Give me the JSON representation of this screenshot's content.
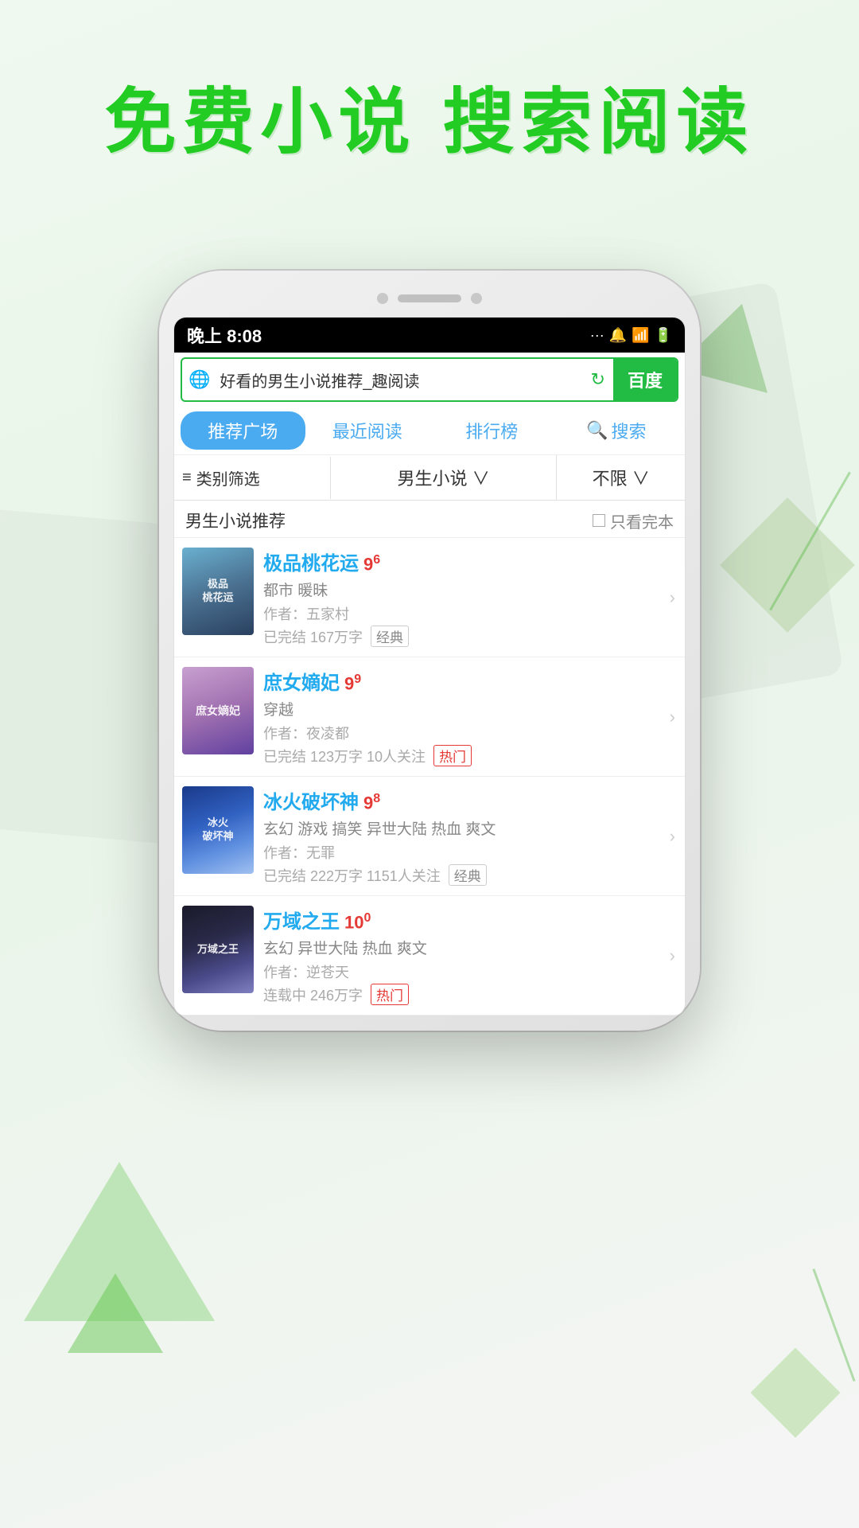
{
  "headline": {
    "line1": "免费小说  搜索阅读"
  },
  "status_bar": {
    "time": "晚上 8:08",
    "icons": "... 🔔 📶 🔋"
  },
  "search": {
    "placeholder": "好看的男生小说推荐_趣阅读",
    "baidu_label": "百度",
    "globe_icon": "🌐",
    "refresh_icon": "↻"
  },
  "nav_tabs": [
    {
      "label": "推荐广场",
      "active": true
    },
    {
      "label": "最近阅读",
      "active": false
    },
    {
      "label": "排行榜",
      "active": false
    },
    {
      "label": "搜索",
      "active": false,
      "has_icon": true
    }
  ],
  "filter": {
    "category_label": "类别筛选",
    "gender_label": "男生小说 ∨",
    "limit_label": "不限 ∨"
  },
  "section": {
    "title": "男生小说推荐",
    "only_complete": "只看完本"
  },
  "books": [
    {
      "title": "极品桃花运",
      "rating": "9",
      "rating_decimal": "6",
      "tags": "都市 暖昧",
      "author": "作者：五家村",
      "status": "已完结 167万字",
      "badge": "经典",
      "badge_hot": false,
      "cover_style": "1",
      "cover_text": "极品\n桃花运"
    },
    {
      "title": "庶女嫡妃",
      "rating": "9",
      "rating_decimal": "9",
      "tags": "穿越",
      "author": "作者：夜凌都",
      "status": "已完结 123万字 10人关注",
      "badge": "热门",
      "badge_hot": true,
      "cover_style": "2",
      "cover_text": "庶女嫡妃"
    },
    {
      "title": "冰火破坏神",
      "rating": "9",
      "rating_decimal": "8",
      "tags": "玄幻 游戏 搞笑 异世大陆 热血 爽文",
      "author": "作者：无罪",
      "status": "已完结 222万字 1151人关注",
      "badge": "经典",
      "badge_hot": false,
      "cover_style": "3",
      "cover_text": "冰火破坏神"
    },
    {
      "title": "万域之王",
      "rating": "10",
      "rating_decimal": "0",
      "tags": "玄幻 异世大陆 热血 爽文",
      "author": "作者：逆苍天",
      "status": "连载中 246万字",
      "badge": "热门",
      "badge_hot": true,
      "cover_style": "4",
      "cover_text": "万域之王"
    }
  ]
}
